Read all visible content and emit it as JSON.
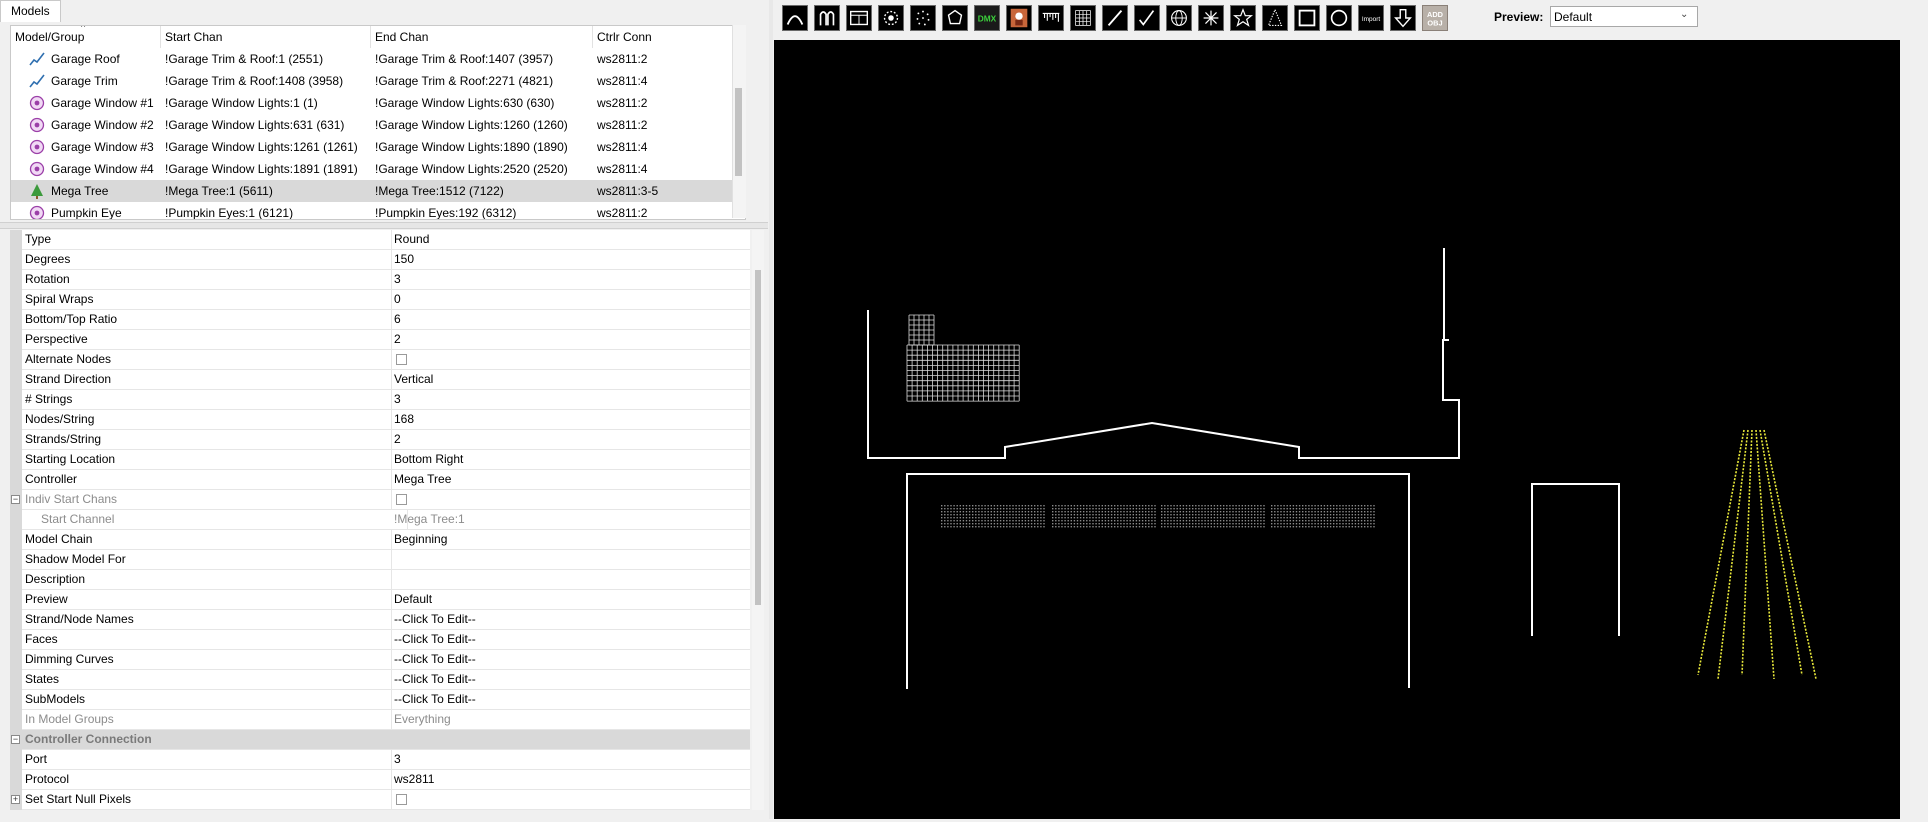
{
  "tabs": {
    "models": "Models"
  },
  "models_list": {
    "columns": [
      "Model/Group",
      "Start Chan",
      "End Chan",
      "Ctrlr Conn"
    ],
    "rows": [
      {
        "icon": "poly-line-icon",
        "name": "Garage Roof",
        "start": "!Garage Trim & Roof:1 (2551)",
        "end": "!Garage Trim & Roof:1407 (3957)",
        "conn": "ws2811:2"
      },
      {
        "icon": "poly-line-icon",
        "name": "Garage Trim",
        "start": "!Garage Trim & Roof:1408 (3958)",
        "end": "!Garage Trim & Roof:2271 (4821)",
        "conn": "ws2811:4"
      },
      {
        "icon": "custom-model-icon",
        "name": "Garage Window #1",
        "start": "!Garage Window Lights:1 (1)",
        "end": "!Garage Window Lights:630 (630)",
        "conn": "ws2811:2"
      },
      {
        "icon": "custom-model-icon",
        "name": "Garage Window #2",
        "start": "!Garage Window Lights:631 (631)",
        "end": "!Garage Window Lights:1260 (1260)",
        "conn": "ws2811:2"
      },
      {
        "icon": "custom-model-icon",
        "name": "Garage Window #3",
        "start": "!Garage Window Lights:1261 (1261)",
        "end": "!Garage Window Lights:1890 (1890)",
        "conn": "ws2811:4"
      },
      {
        "icon": "custom-model-icon",
        "name": "Garage Window #4",
        "start": "!Garage Window Lights:1891 (1891)",
        "end": "!Garage Window Lights:2520 (2520)",
        "conn": "ws2811:4"
      },
      {
        "icon": "tree-icon",
        "name": "Mega Tree",
        "start": "!Mega Tree:1 (5611)",
        "end": "!Mega Tree:1512 (7122)",
        "conn": "ws2811:3-5",
        "selected": true
      },
      {
        "icon": "custom-model-icon",
        "name": "Pumpkin Eye",
        "start": "!Pumpkin Eyes:1 (6121)",
        "end": "!Pumpkin Eyes:192 (6312)",
        "conn": "ws2811:2"
      }
    ]
  },
  "properties": [
    {
      "name": "Type",
      "value": "Round"
    },
    {
      "name": "Degrees",
      "value": "150"
    },
    {
      "name": "Rotation",
      "value": "3"
    },
    {
      "name": "Spiral Wraps",
      "value": "0"
    },
    {
      "name": "Bottom/Top Ratio",
      "value": "6"
    },
    {
      "name": "Perspective",
      "value": "2"
    },
    {
      "name": "Alternate Nodes",
      "value": "",
      "checkbox": true
    },
    {
      "name": "Strand Direction",
      "value": "Vertical"
    },
    {
      "name": "# Strings",
      "value": "3"
    },
    {
      "name": "Nodes/String",
      "value": "168"
    },
    {
      "name": "Strands/String",
      "value": "2"
    },
    {
      "name": "Starting Location",
      "value": "Bottom Right"
    },
    {
      "name": "Controller",
      "value": "Mega Tree"
    },
    {
      "name": "Indiv Start Chans",
      "value": "",
      "checkbox": true,
      "disabled": true,
      "toggle": "−"
    },
    {
      "name": "Start Channel",
      "value": "!Mega Tree:1",
      "disabled": true,
      "indent": true
    },
    {
      "name": "Model Chain",
      "value": "Beginning"
    },
    {
      "name": "Shadow Model For",
      "value": ""
    },
    {
      "name": "Description",
      "value": ""
    },
    {
      "name": "Preview",
      "value": "Default"
    },
    {
      "name": "Strand/Node Names",
      "value": "--Click To Edit--"
    },
    {
      "name": "Faces",
      "value": "--Click To Edit--"
    },
    {
      "name": "Dimming Curves",
      "value": "--Click To Edit--"
    },
    {
      "name": "States",
      "value": "--Click To Edit--"
    },
    {
      "name": "SubModels",
      "value": "--Click To Edit--"
    },
    {
      "name": "In Model Groups",
      "value": "Everything",
      "disabled": true
    },
    {
      "name": "Controller Connection",
      "value": "",
      "category": true,
      "toggle": "−"
    },
    {
      "name": "Port",
      "value": "3"
    },
    {
      "name": "Protocol",
      "value": "ws2811"
    },
    {
      "name": "Set Start Null Pixels",
      "value": "",
      "checkbox": true,
      "toggle": "+"
    }
  ],
  "toolbar": {
    "tools": [
      "arch-icon",
      "candy-cane-icon",
      "channel-block-icon",
      "circle-model-icon",
      "cube-icon",
      "custom-model-icon",
      "dmx-icon",
      "image-model-icon",
      "icicles-icon",
      "matrix-icon",
      "single-line-icon",
      "poly-line-icon",
      "sphere-icon",
      "spinner-icon",
      "star-icon",
      "tree-model-icon",
      "window-frame-icon",
      "wreath-icon",
      "import-icon",
      "download-icon",
      "add-object-icon"
    ],
    "dmx_label": "DMX",
    "import_label": "Import",
    "add_obj_label": "ADD OBJ"
  },
  "preview": {
    "label": "Preview:",
    "selected": "Default"
  },
  "colors": {
    "canvas_bg": "#000000",
    "outline": "#ffffff",
    "tree": "#e8e83a",
    "selection": "#d9d9d9"
  }
}
